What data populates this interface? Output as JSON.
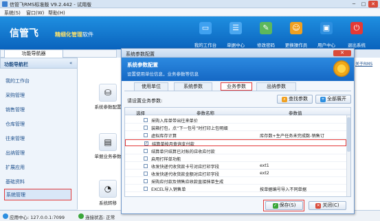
{
  "window": {
    "title": "信管飞RMS标准版 V9.2.442 - 试用版",
    "min": "─",
    "max": "□",
    "close": "✕"
  },
  "menu": [
    "系统(S)",
    "窗口(W)",
    "帮助(H)"
  ],
  "banner": {
    "logo": "信管飞",
    "slogan_a": "精细化管理",
    "slogan_b": "软件",
    "buttons": [
      "我的工作台",
      "单据中心",
      "修改密码",
      "更换操作员",
      "用户中心",
      "退出系统"
    ],
    "colors": [
      "#3fa1f0",
      "#4aa7f0",
      "#5cb85c",
      "#f0a020",
      "#2d8fe0",
      "#e53935"
    ]
  },
  "left_panel": {
    "tab": "功能导航器",
    "header": "功能导航栏",
    "collapse": "«",
    "items": [
      "我的工作台",
      "采购管理",
      "销售管理",
      "仓库管理",
      "往来管理",
      "出纳管理",
      "扩展应用",
      "基础资料",
      "系统管理"
    ]
  },
  "work_area": {
    "items": [
      "系统参数配置",
      "单据业务参数",
      "系统转移"
    ],
    "right_link": "关于RMS"
  },
  "status": {
    "server": "应用中心: 127.0.0.1:7099",
    "conn": "连接状态: 正常"
  },
  "dialog": {
    "title": "系统参数配置",
    "close": "✕",
    "header_title": "系统参数配置",
    "header_sub": "设置使用单位信息，业务参数等信息",
    "tabs": [
      "使用单位",
      "系统参数",
      "业务参数",
      "出纳参数"
    ],
    "selected_tab": 2,
    "setting_label": "请设置业务参数:",
    "search_btn": "查找参数",
    "expand_btn": "全部展开",
    "columns": [
      "选择",
      "参数名称",
      "参数值"
    ],
    "rows": [
      {
        "checked": false,
        "name": "采购入库单带出往来单价",
        "value": ""
      },
      {
        "checked": false,
        "name": "装箱打包，点“下一包号”时打印上包明细",
        "value": ""
      },
      {
        "checked": false,
        "name": "虚拟库存计算",
        "value": "库存数+生产任务未完成数-销售订"
      },
      {
        "checked": true,
        "name": "结算单按月查询支付款",
        "value": ""
      },
      {
        "checked": false,
        "name": "结算单只结算已对账的应收应付款",
        "value": ""
      },
      {
        "checked": false,
        "name": "启用打样单功能",
        "value": ""
      },
      {
        "checked": false,
        "name": "收发快递代收货款卡号对应打印字段",
        "value": "ext1"
      },
      {
        "checked": false,
        "name": "收发快递代收货款金额对应打印字段",
        "value": "ext2"
      },
      {
        "checked": false,
        "name": "采购应付款及销售应收款直接抹单生成",
        "value": ""
      },
      {
        "checked": false,
        "name": "EXCEL导入销售单",
        "value": "按单据编号导入不同单据"
      }
    ],
    "save_btn": "保存(S)",
    "close_btn": "关闭(C)"
  }
}
